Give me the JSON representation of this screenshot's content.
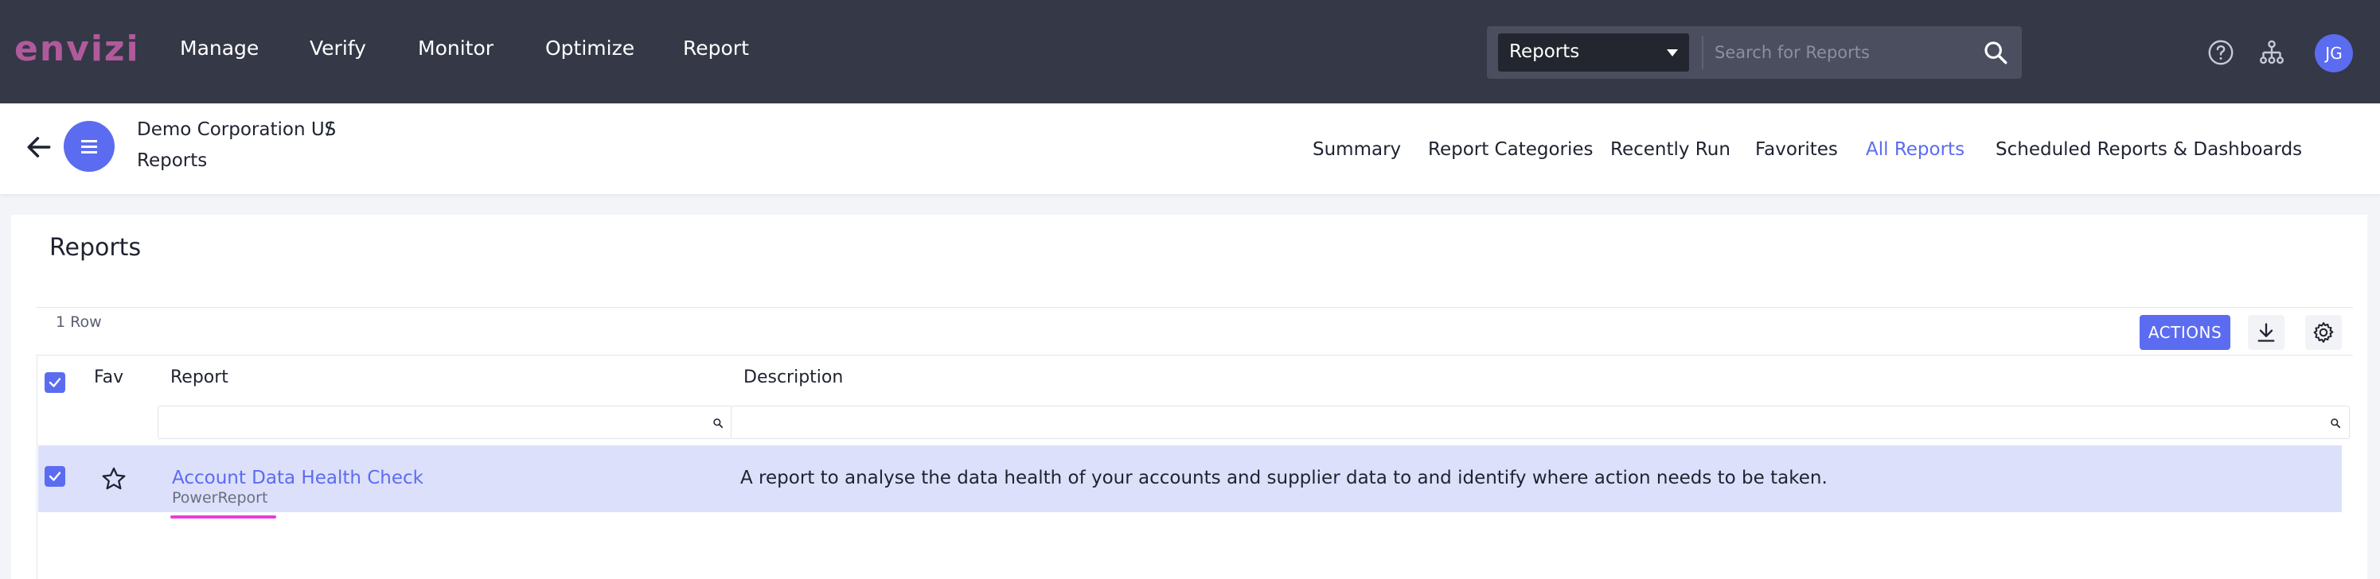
{
  "app": {
    "logo_text": "envizi",
    "brand_color": "#b05a9c",
    "accent_color": "#5b6cf0"
  },
  "nav": {
    "items": [
      {
        "label": "Manage"
      },
      {
        "label": "Verify"
      },
      {
        "label": "Monitor"
      },
      {
        "label": "Optimize"
      },
      {
        "label": "Report"
      }
    ]
  },
  "search": {
    "scope_value": "Reports",
    "placeholder": "Search for Reports",
    "icon": "search-icon"
  },
  "header_icons": {
    "help": "help-icon",
    "hierarchy": "hierarchy-icon",
    "user_initials": "JG"
  },
  "breadcrumb": {
    "parent": "Demo Corporation US",
    "separator": "/",
    "current": "Reports"
  },
  "tabs": [
    {
      "label": "Summary",
      "active": false
    },
    {
      "label": "Report Categories",
      "active": false
    },
    {
      "label": "Recently Run",
      "active": false
    },
    {
      "label": "Favorites",
      "active": false
    },
    {
      "label": "All Reports",
      "active": true
    },
    {
      "label": "Scheduled Reports & Dashboards",
      "active": false
    }
  ],
  "panel": {
    "title": "Reports",
    "row_count": "1 Row",
    "actions_label": "ACTIONS",
    "download_icon": "download-icon",
    "settings_icon": "gear-icon"
  },
  "grid": {
    "columns": {
      "fav": "Fav",
      "report": "Report",
      "description": "Description"
    },
    "rows": [
      {
        "selected": true,
        "favorite": false,
        "report_name": "Account Data Health Check",
        "report_type": "PowerReport",
        "description": "A report to analyse the data health of your accounts and supplier data to and identify where action needs to be taken."
      }
    ]
  }
}
